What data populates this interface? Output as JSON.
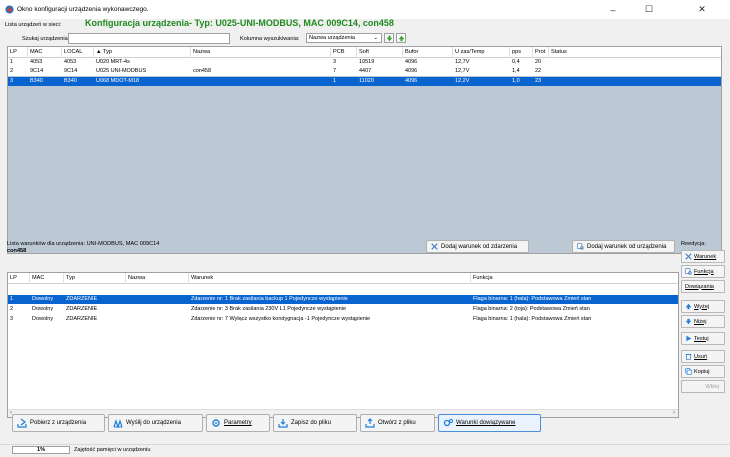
{
  "window": {
    "title": "Okno konfiguracji urządzenia wykonawczego."
  },
  "header": {
    "devices_list_label": "Lista urządzeń w sieci:",
    "config_title": "Konfiguracja urządzenia- Typ: U025-UNI-MODBUS, MAC 009C14, con458"
  },
  "search": {
    "label": "Szukaj urządzenia:",
    "value": "",
    "column_label": "Kolumna wyszukiwania:",
    "column_value": "Nazwa urządzenia"
  },
  "devices_table": {
    "columns": [
      "LP",
      "MAC",
      "LOCAL",
      "▲ Typ",
      "Nazwa",
      "PCB",
      "Soft",
      "Bufor",
      "U zas/Temp",
      "pps",
      "Prot",
      "Status"
    ],
    "rows": [
      [
        "1",
        "4053",
        "4053",
        "U020 MRT-4s",
        "",
        "3",
        "10519",
        "4096",
        "12,7V",
        "0,4",
        "20",
        ""
      ],
      [
        "2",
        "9C14",
        "9C14",
        "U025 UNI-MODBUS",
        "con458",
        "7",
        "4407",
        "4096",
        "12,7V",
        "1,4",
        "22",
        ""
      ],
      [
        "3",
        "B340",
        "B340",
        "U068 MDOT-M18",
        "",
        "1",
        "11020",
        "4096",
        "12,2V",
        "1,0",
        "23",
        ""
      ]
    ],
    "selected_row": 3
  },
  "conditions": {
    "title_line1": "Lista warunków dla urządzenia: UNI-MODBUS, MAC 009C14",
    "title_line2": "con458",
    "add_from_event_label": "Dodaj warunek od zdarzenia",
    "add_from_device_label": "Dodaj warunek od urządzenia",
    "columns": [
      "LP",
      "MAC",
      "Typ",
      "Nazwa",
      "Warunek",
      "Funkcja"
    ],
    "rows": [
      [
        "1",
        "Dowolny",
        "ZDARZENIE",
        "",
        "Zdarzenie nr: 1 Brak zasilania backup 1 Pojedyncze wystąpienie",
        "Flaga binarna:  1 (hala): Podstawowa Zmień stan"
      ],
      [
        "2",
        "Dowolny",
        "ZDARZENIE",
        "",
        "Zdarzenie nr: 3 Brak zasilania 230V L1 Pojedyncze wystąpienie",
        "Flaga binarna:  2 (toja): Podstawowa Zmień stan"
      ],
      [
        "3",
        "Dowolny",
        "ZDARZENIE",
        "",
        "Zdarzenie nr: 7 Wyłącz wszystko kondygnacja -1 Pojedyncze wystąpienie",
        "Flaga binarna:  1 (hala): Podstawowa Zmień stan"
      ]
    ],
    "selected_row": 1
  },
  "edit_panel": {
    "title": "Reedycja:",
    "condition": "Warunek",
    "function": "Funkcja",
    "binding": "Dowiązania",
    "up": "Wyżej",
    "down": "Niżej",
    "test": "Testuj",
    "delete": "Usuń",
    "copy": "Kopiuj",
    "paste": "Wklej"
  },
  "toolbar": {
    "fetch": "Pobierz z urządzenia",
    "send": "Wyślij do urządzenia",
    "params": "Parametry",
    "save": "Zapisz do pliku",
    "open": "Otwórz z pliku",
    "bound": "Warunki dowiązywane"
  },
  "status": {
    "memory_percent": "1%",
    "memory_label": "Zajętość pamięci w urządzeniu"
  },
  "colors": {
    "accent": "#0a64d0",
    "title_green": "#1e8a1e",
    "icon_blue": "#1f7fd8"
  }
}
